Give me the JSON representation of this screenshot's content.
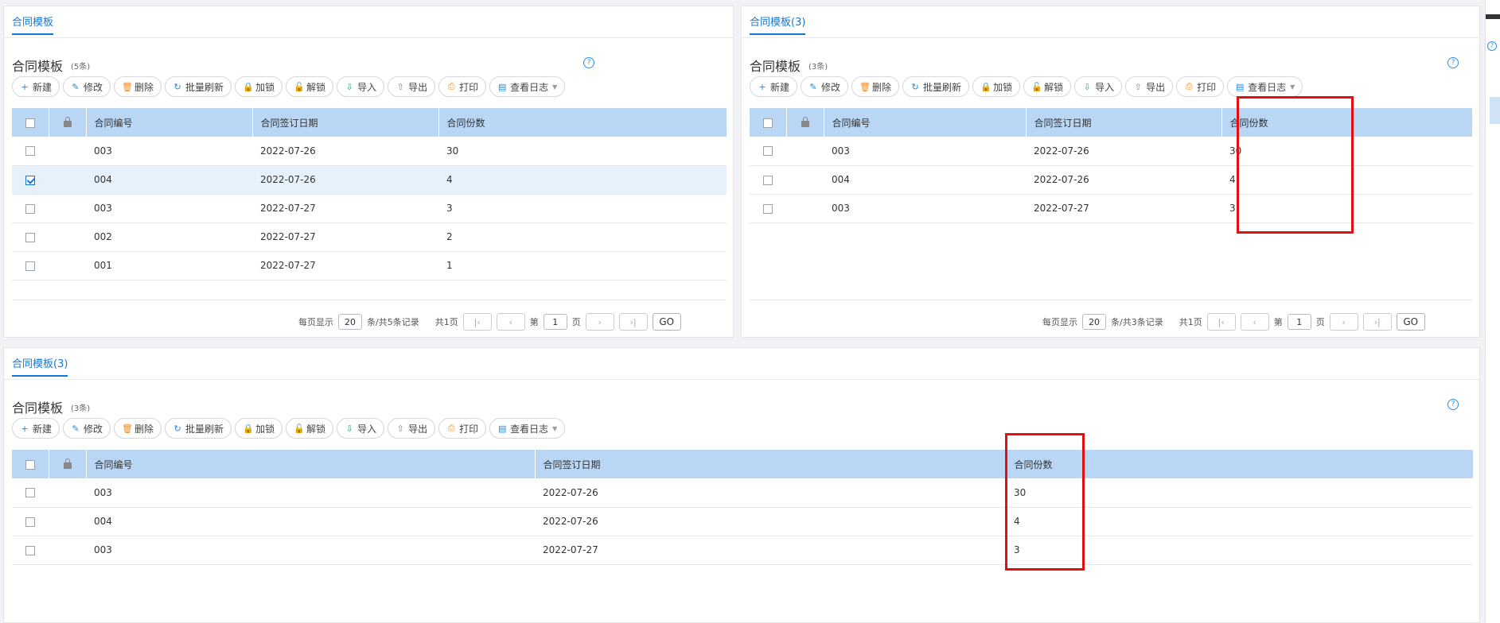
{
  "toolbar_buttons": [
    {
      "label": "新建",
      "icon": "plus-icon",
      "glyph": "+",
      "color": "blue"
    },
    {
      "label": "修改",
      "icon": "edit-icon",
      "glyph": "✎",
      "color": "blue"
    },
    {
      "label": "删除",
      "icon": "trash-icon",
      "glyph": "🗑",
      "color": "orange"
    },
    {
      "label": "批量刷新",
      "icon": "refresh-icon",
      "glyph": "↻",
      "color": "blue"
    },
    {
      "label": "加锁",
      "icon": "lock-icon",
      "glyph": "🔒",
      "color": "blue"
    },
    {
      "label": "解锁",
      "icon": "unlock-icon",
      "glyph": "🔓",
      "color": "blue"
    },
    {
      "label": "导入",
      "icon": "import-icon",
      "glyph": "⇩",
      "color": "green"
    },
    {
      "label": "导出",
      "icon": "export-icon",
      "glyph": "⇧",
      "color": "gray"
    },
    {
      "label": "打印",
      "icon": "print-icon",
      "glyph": "⎙",
      "color": "orange"
    },
    {
      "label": "查看日志",
      "icon": "log-icon",
      "glyph": "▤",
      "color": "blue",
      "dropdown": true
    }
  ],
  "columns": {
    "code": "合同编号",
    "date": "合同签订日期",
    "copies": "合同份数"
  },
  "help_glyph": "?",
  "panel1": {
    "tab": "合同模板",
    "title": "合同模板",
    "count": "(5条)",
    "rows": [
      {
        "code": "003",
        "date": "2022-07-26",
        "copies": "30",
        "checked": false
      },
      {
        "code": "004",
        "date": "2022-07-26",
        "copies": "4",
        "checked": true
      },
      {
        "code": "003",
        "date": "2022-07-27",
        "copies": "3",
        "checked": false
      },
      {
        "code": "002",
        "date": "2022-07-27",
        "copies": "2",
        "checked": false
      },
      {
        "code": "001",
        "date": "2022-07-27",
        "copies": "1",
        "checked": false
      }
    ],
    "pager": {
      "per_page_label": "每页显示",
      "per_page": "20",
      "summary": "条/共5条记录",
      "total_pages": "共1页",
      "page_prefix": "第",
      "page": "1",
      "page_suffix": "页",
      "go": "GO"
    }
  },
  "panel2": {
    "tab": "合同模板(3)",
    "title": "合同模板",
    "count": "(3条)",
    "rows": [
      {
        "code": "003",
        "date": "2022-07-26",
        "copies": "30",
        "checked": false
      },
      {
        "code": "004",
        "date": "2022-07-26",
        "copies": "4",
        "checked": false
      },
      {
        "code": "003",
        "date": "2022-07-27",
        "copies": "3",
        "checked": false
      }
    ],
    "pager": {
      "per_page_label": "每页显示",
      "per_page": "20",
      "summary": "条/共3条记录",
      "total_pages": "共1页",
      "page_prefix": "第",
      "page": "1",
      "page_suffix": "页",
      "go": "GO"
    }
  },
  "panel3": {
    "tab": "合同模板(3)",
    "title": "合同模板",
    "count": "(3条)",
    "rows": [
      {
        "code": "003",
        "date": "2022-07-26",
        "copies": "30",
        "checked": false
      },
      {
        "code": "004",
        "date": "2022-07-26",
        "copies": "4",
        "checked": false
      },
      {
        "code": "003",
        "date": "2022-07-27",
        "copies": "3",
        "checked": false
      }
    ]
  },
  "colors": {
    "accent": "#1677d2",
    "header_bg": "#b9d6f4",
    "selected_row": "#e7f1fb",
    "highlight_box": "#e01010"
  }
}
